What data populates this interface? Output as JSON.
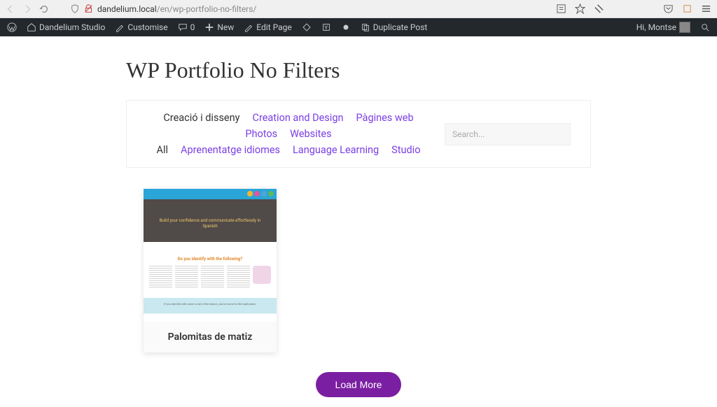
{
  "browser": {
    "url_host": "dandelium.local",
    "url_path": "/en/wp-portfolio-no-filters/"
  },
  "wp_bar": {
    "site_name": "Dandelium Studio",
    "customise": "Customise",
    "comments": "0",
    "new": "New",
    "edit_page": "Edit Page",
    "duplicate": "Duplicate Post",
    "greeting": "Hi, Montse"
  },
  "page": {
    "title": "WP Portfolio No Filters",
    "search_placeholder": "Search..."
  },
  "filters": {
    "row1": [
      {
        "label": "Creació i disseny",
        "dark": true
      },
      {
        "label": "Creation and Design",
        "dark": false
      },
      {
        "label": "Pàgines web",
        "dark": false
      }
    ],
    "row2": [
      {
        "label": "Photos",
        "dark": false
      },
      {
        "label": "Websites",
        "dark": false
      }
    ],
    "row3": [
      {
        "label": "All",
        "dark": true
      },
      {
        "label": "Aprenentatge idiomes",
        "dark": false
      },
      {
        "label": "Language Learning",
        "dark": false
      },
      {
        "label": "Studio",
        "dark": false
      }
    ]
  },
  "cards": [
    {
      "title": "Palomitas de matiz",
      "thumb_hero": "Build your confidence and communicate effortlessly in Spanish",
      "thumb_head": "Do you identify with the following?",
      "thumb_band": "If you identify with some or all of the above, you've come to the right place."
    }
  ],
  "load_more": "Load More"
}
